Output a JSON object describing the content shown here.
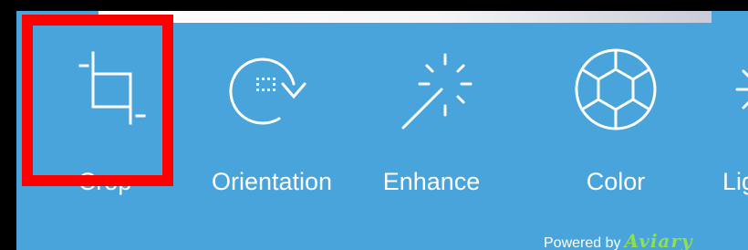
{
  "tools": [
    {
      "label": "Crop",
      "icon": "crop-icon",
      "selected": true
    },
    {
      "label": "Orientation",
      "icon": "rotate-icon",
      "selected": false
    },
    {
      "label": "Enhance",
      "icon": "magic-wand-icon",
      "selected": false
    },
    {
      "label": "Color",
      "icon": "color-wheel-icon",
      "selected": false
    },
    {
      "label": "Lig",
      "icon": "sun-icon",
      "selected": false
    }
  ],
  "footer": {
    "powered_prefix": "Powered by",
    "brand": "Aviary"
  },
  "colors": {
    "toolbar_bg": "#49a4db",
    "selection_border": "#ff0000",
    "brand_green": "#8fe04a",
    "icon_white": "#ffffff"
  }
}
